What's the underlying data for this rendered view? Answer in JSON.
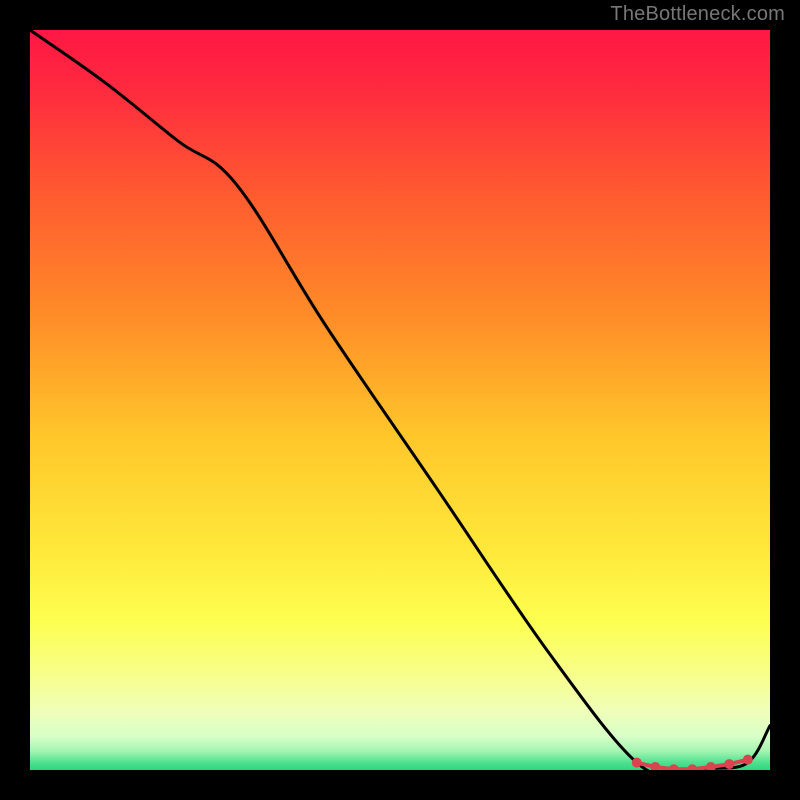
{
  "watermark": "TheBottleneck.com",
  "chart_data": {
    "type": "line",
    "title": "",
    "xlabel": "",
    "ylabel": "",
    "xlim": [
      0,
      100
    ],
    "ylim": [
      0,
      100
    ],
    "gradient_stops": [
      {
        "offset": 0.0,
        "color": "#ff1744"
      },
      {
        "offset": 0.08,
        "color": "#ff2a3f"
      },
      {
        "offset": 0.22,
        "color": "#ff5a30"
      },
      {
        "offset": 0.38,
        "color": "#ff8a28"
      },
      {
        "offset": 0.55,
        "color": "#ffc72a"
      },
      {
        "offset": 0.7,
        "color": "#ffe83a"
      },
      {
        "offset": 0.8,
        "color": "#fdff50"
      },
      {
        "offset": 0.87,
        "color": "#f7ff8a"
      },
      {
        "offset": 0.92,
        "color": "#efffb8"
      },
      {
        "offset": 0.955,
        "color": "#d8ffc8"
      },
      {
        "offset": 0.975,
        "color": "#a0f5b0"
      },
      {
        "offset": 0.99,
        "color": "#4fe090"
      },
      {
        "offset": 1.0,
        "color": "#2fd682"
      }
    ],
    "series": [
      {
        "name": "curve",
        "x": [
          0,
          10,
          20,
          28,
          40,
          55,
          70,
          82,
          88,
          92,
          97,
          100
        ],
        "y": [
          100,
          93,
          85,
          79,
          60,
          38,
          16,
          1,
          0,
          0.2,
          1,
          6
        ]
      }
    ],
    "markers": {
      "name": "highlight",
      "x": [
        82,
        84.5,
        87,
        89.5,
        92,
        94.5,
        97
      ],
      "y": [
        1.0,
        0.4,
        0.1,
        0.1,
        0.4,
        0.8,
        1.4
      ],
      "color": "#d9444f",
      "radius": 5
    }
  }
}
